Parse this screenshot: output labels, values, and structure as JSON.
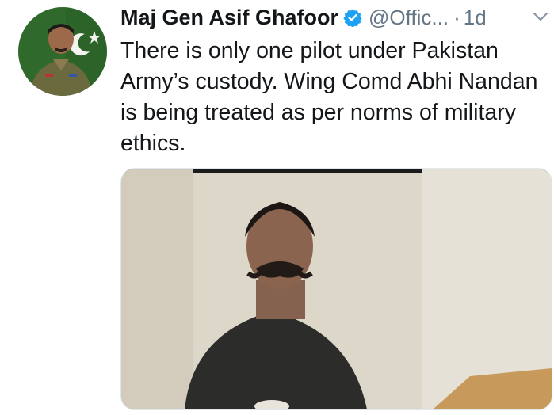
{
  "tweet": {
    "author_name": "Maj Gen Asif Ghafoor",
    "handle": "@Offic...",
    "separator": "·",
    "time": "1d",
    "text": "There is only one pilot under Pakistan Army’s custody. Wing Comd Abhi Nandan is being treated as per norms of military ethics.",
    "verified": true,
    "icons": {
      "verified": "verified-badge-icon",
      "menu": "chevron-down-icon"
    },
    "colors": {
      "name": "#14171a",
      "secondary": "#657786",
      "verified": "#1da1f2"
    }
  }
}
